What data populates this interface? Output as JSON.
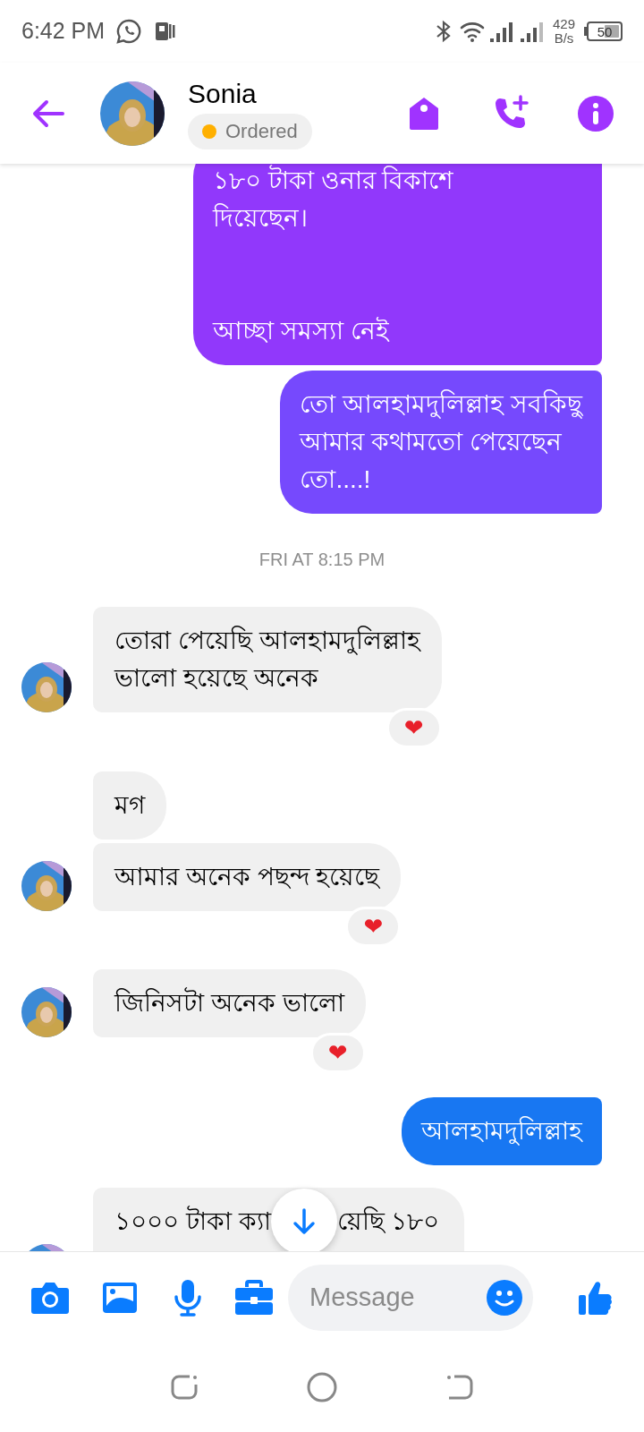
{
  "status_bar": {
    "time": "6:42 PM",
    "net_speed": "429",
    "net_unit": "B/s",
    "battery": "50"
  },
  "header": {
    "name": "Sonia",
    "status": "Ordered"
  },
  "messages": [
    {
      "kind": "sent",
      "text": "১৮০ টাকা ওনার বিকাশে\nদিয়েছেন।\n\n\nআচ্ছা সমস্যা নেই",
      "color": "#9138fb"
    },
    {
      "kind": "sent",
      "text": "তো আলহামদুলিল্লাহ সবকিছু\nআমার কথামতো পেয়েছেন\nতো....!",
      "color": "#7649fd"
    },
    {
      "kind": "timestamp",
      "text": "FRI AT 8:15 PM"
    },
    {
      "kind": "received",
      "text": "তোরা পেয়েছি আলহামদুলিল্লাহ\nভালো হয়েছে অনেক",
      "avatar": true,
      "reaction": "❤"
    },
    {
      "kind": "received",
      "text": "মগ",
      "avatar": false
    },
    {
      "kind": "received",
      "text": "আমার অনেক পছন্দ হয়েছে",
      "avatar": true,
      "reaction": "❤"
    },
    {
      "kind": "received",
      "text": "জিনিসটা অনেক ভালো",
      "avatar": true,
      "reaction": "❤"
    },
    {
      "kind": "sent",
      "text": "আলহামদুলিল্লাহ",
      "color": "#1877f2"
    },
    {
      "kind": "received",
      "text": "১০০০ টাকা ক্যা",
      "text_after": "য়েছি ১৮০",
      "avatar": true,
      "covered": true
    }
  ],
  "composer": {
    "placeholder": "Message"
  }
}
